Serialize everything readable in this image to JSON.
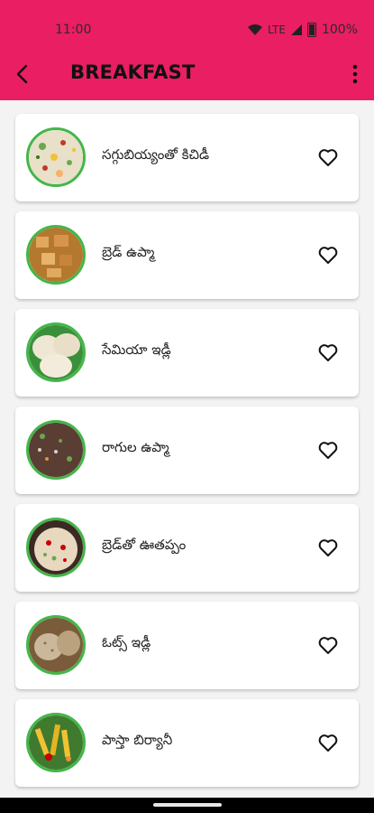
{
  "status_bar": {
    "time": "11:00",
    "network": "LTE",
    "battery": "100%"
  },
  "toolbar": {
    "title": "BREAKFAST",
    "back_icon": "back-arrow-icon",
    "menu_icon": "more-vert-icon"
  },
  "colors": {
    "app_bar": "#e91e63",
    "thumb_border": "#43b649"
  },
  "recipes": [
    {
      "name": "సగ్గుబియ్యంతో కిచిడీ",
      "image": "sabudana-khichdi"
    },
    {
      "name": "బ్రెడ్ ఉప్మా",
      "image": "bread-upma"
    },
    {
      "name": "సేమియా ఇడ్లీ",
      "image": "semiya-idli"
    },
    {
      "name": "రాగుల ఉప్మా",
      "image": "ragi-upma"
    },
    {
      "name": "బ్రెడ్‌తో ఊతప్పం",
      "image": "bread-uttapam"
    },
    {
      "name": "ఓట్స్ ఇడ్లీ",
      "image": "oats-idli"
    },
    {
      "name": "పాస్తా బిర్యానీ",
      "image": "pasta-biryani"
    }
  ]
}
